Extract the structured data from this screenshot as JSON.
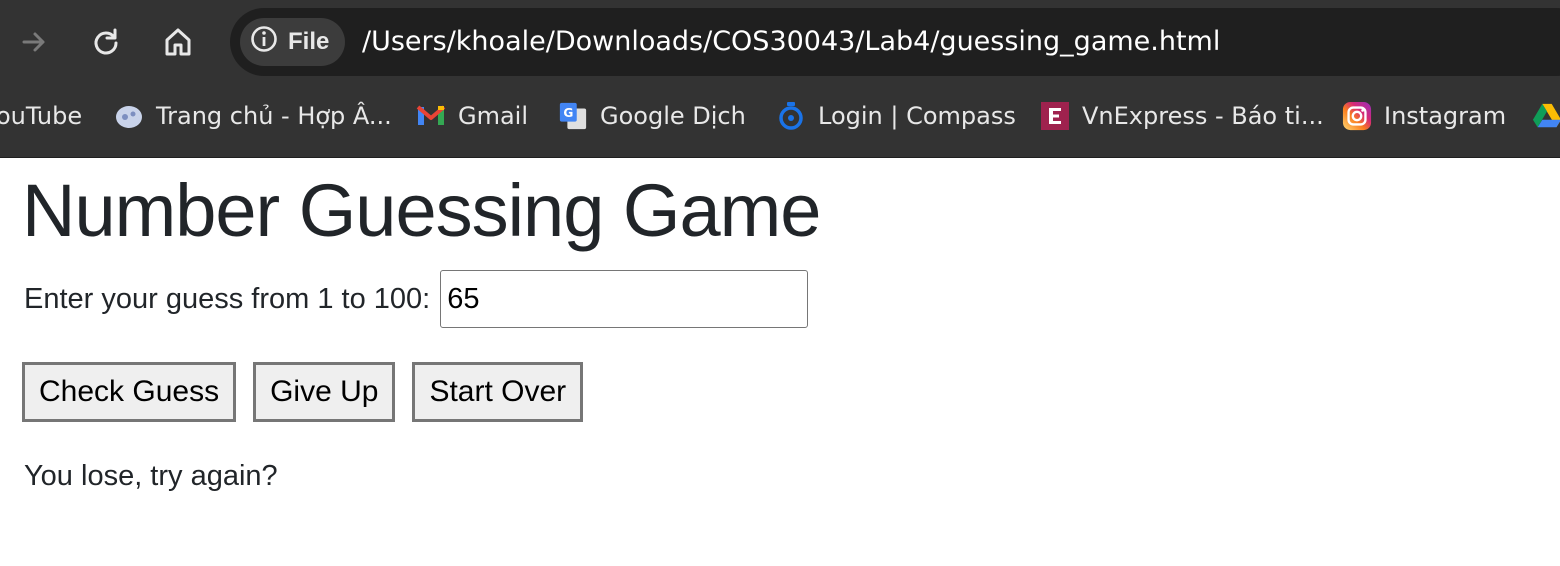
{
  "browser": {
    "chip_label": "File",
    "url": "/Users/khoale/Downloads/COS30043/Lab4/guessing_game.html",
    "bookmarks": [
      {
        "label": "ouTube",
        "icon": "youtube-icon"
      },
      {
        "label": "Trang chủ - Hợp Â...",
        "icon": "hopam-icon"
      },
      {
        "label": "Gmail",
        "icon": "gmail-icon"
      },
      {
        "label": "Google Dịch",
        "icon": "google-translate-icon"
      },
      {
        "label": "Login | Compass",
        "icon": "compass-icon"
      },
      {
        "label": "VnExpress - Báo ti...",
        "icon": "vnexpress-icon"
      },
      {
        "label": "Instagram",
        "icon": "instagram-icon"
      }
    ],
    "colors": {
      "toolbar_bg": "#333333",
      "omnibox_bg": "#1f1f1f"
    }
  },
  "page": {
    "title": "Number Guessing Game",
    "prompt_label": "Enter your guess from 1 to 100:",
    "guess_value": "65",
    "buttons": {
      "check": "Check Guess",
      "give_up": "Give Up",
      "start_over": "Start Over"
    },
    "result_message": "You lose, try again?"
  }
}
